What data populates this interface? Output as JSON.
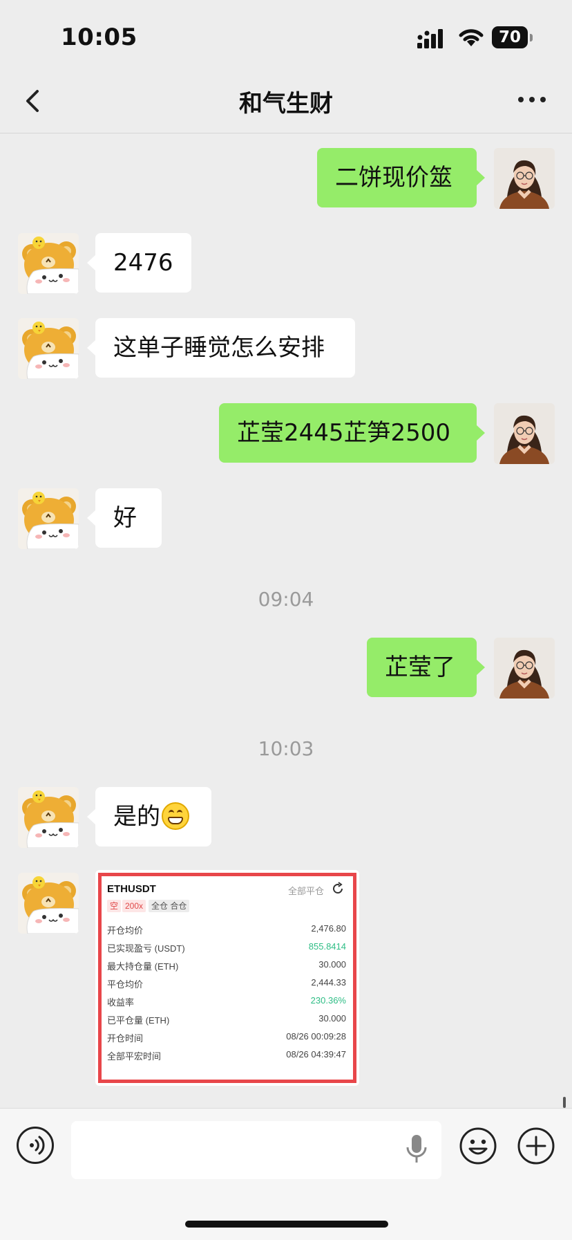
{
  "status_bar": {
    "time": "10:05",
    "battery": "70"
  },
  "nav": {
    "title": "和气生财"
  },
  "messages": [
    {
      "side": "out",
      "text": "二饼现价筮"
    },
    {
      "side": "in",
      "text": "2476"
    },
    {
      "side": "in",
      "text": "这单子睡觉怎么安排"
    },
    {
      "side": "out",
      "text": "芷莹2445芷笋2500"
    },
    {
      "side": "in",
      "text": "好"
    },
    {
      "side": "out",
      "text": "芷莹了"
    },
    {
      "side": "in",
      "text": "是的",
      "emoji": "grinning-face-emoji"
    }
  ],
  "timestamps": [
    "09:04",
    "10:03"
  ],
  "card": {
    "symbol": "ETHUSDT",
    "close_all": "全部平仓",
    "tags": [
      "空",
      "200x",
      "全仓 合仓"
    ],
    "rows": [
      {
        "label": "开仓均价",
        "value": "2,476.80"
      },
      {
        "label": "已实现盈亏 (USDT)",
        "value": "855.8414",
        "color": "#2ebd85"
      },
      {
        "label": "最大持仓量 (ETH)",
        "value": "30.000"
      },
      {
        "label": "平仓均价",
        "value": "2,444.33"
      },
      {
        "label": "收益率",
        "value": "230.36%",
        "color": "#2ebd85"
      },
      {
        "label": "已平仓量 (ETH)",
        "value": "30.000"
      },
      {
        "label": "开仓时间",
        "value": "08/26 00:09:28"
      },
      {
        "label": "全部平宏时间",
        "value": "08/26 04:39:47"
      }
    ]
  },
  "input": {
    "placeholder": ""
  },
  "icons": {
    "back": "chevron-left-icon",
    "more": "more-dots-icon",
    "voice": "voice-wave-icon",
    "mic": "microphone-icon",
    "emoji": "smiley-icon",
    "plus": "plus-icon"
  },
  "colors": {
    "outgoing_bubble": "#95ec69",
    "incoming_bubble": "#ffffff",
    "background": "#ededed",
    "card_border": "#e8464a",
    "profit": "#2ebd85"
  }
}
